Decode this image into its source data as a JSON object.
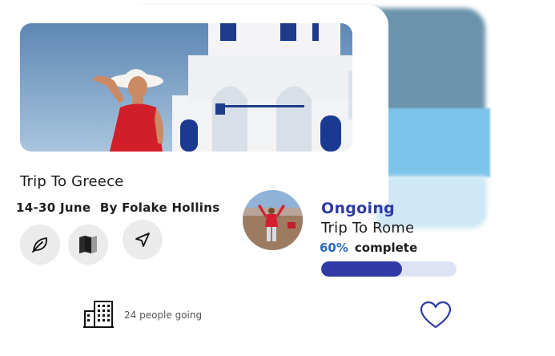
{
  "trip": {
    "title": "Trip To Greece",
    "dates": "14-30 June",
    "author": "By Folake Hollins",
    "people_going": "24 people going"
  },
  "icons": {
    "leaf": "leaf-icon",
    "map": "map-icon",
    "navigate": "navigation-arrow-icon",
    "building": "building-icon",
    "heart": "heart-icon"
  },
  "current": {
    "status": "Ongoing",
    "trip": "Trip To Rome",
    "percent_label": "60%",
    "complete_label": "complete",
    "progress": 0.6
  },
  "colors": {
    "accent": "#2f3aa6",
    "percent": "#2a6cc0"
  }
}
